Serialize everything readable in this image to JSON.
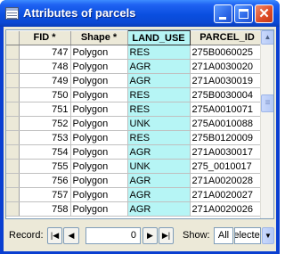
{
  "window": {
    "title": "Attributes of parcels"
  },
  "columns": {
    "fid": "FID *",
    "shape": "Shape *",
    "land_use": "LAND_USE",
    "parcel_id": "PARCEL_ID"
  },
  "rows": [
    {
      "fid": "747",
      "shape": "Polygon",
      "land_use": "RES",
      "parcel_id": "275B0060025"
    },
    {
      "fid": "748",
      "shape": "Polygon",
      "land_use": "AGR",
      "parcel_id": "271A0030020"
    },
    {
      "fid": "749",
      "shape": "Polygon",
      "land_use": "AGR",
      "parcel_id": "271A0030019"
    },
    {
      "fid": "750",
      "shape": "Polygon",
      "land_use": "RES",
      "parcel_id": "275B0030004"
    },
    {
      "fid": "751",
      "shape": "Polygon",
      "land_use": "RES",
      "parcel_id": "275A0010071"
    },
    {
      "fid": "752",
      "shape": "Polygon",
      "land_use": "UNK",
      "parcel_id": "275A0010088"
    },
    {
      "fid": "753",
      "shape": "Polygon",
      "land_use": "RES",
      "parcel_id": "275B0120009"
    },
    {
      "fid": "754",
      "shape": "Polygon",
      "land_use": "AGR",
      "parcel_id": "271A0030017"
    },
    {
      "fid": "755",
      "shape": "Polygon",
      "land_use": "UNK",
      "parcel_id": "275_0010017"
    },
    {
      "fid": "756",
      "shape": "Polygon",
      "land_use": "AGR",
      "parcel_id": "271A0020028"
    },
    {
      "fid": "757",
      "shape": "Polygon",
      "land_use": "AGR",
      "parcel_id": "271A0020027"
    },
    {
      "fid": "758",
      "shape": "Polygon",
      "land_use": "AGR",
      "parcel_id": "271A0020026"
    }
  ],
  "navbar": {
    "record_label": "Record:",
    "record_value": "0",
    "show_label": "Show:",
    "all_label": "All",
    "selected_label": "Selected"
  },
  "colors": {
    "selected_column": "#b6f5f5",
    "titlebar": "#0a4fe0"
  }
}
